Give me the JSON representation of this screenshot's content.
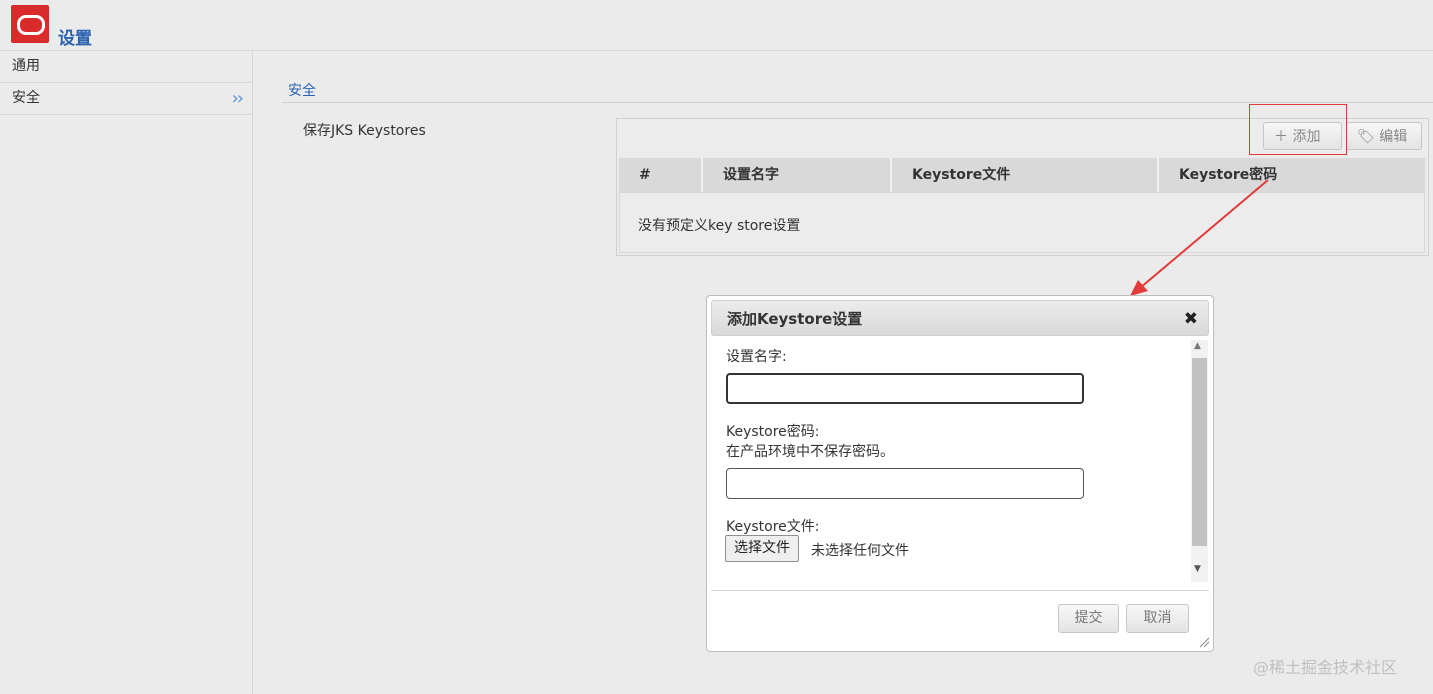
{
  "header": {
    "title": "设置"
  },
  "sidebar": {
    "items": [
      {
        "label": "通用"
      },
      {
        "label": "安全"
      }
    ]
  },
  "section": {
    "title": "安全",
    "field_label": "保存JKS Keystores"
  },
  "toolbar": {
    "add_label": "添加",
    "edit_label": "编辑"
  },
  "table": {
    "columns": [
      "#",
      "设置名字",
      "Keystore文件",
      "Keystore密码"
    ],
    "empty_message": "没有预定义key store设置"
  },
  "dialog": {
    "title": "添加Keystore设置",
    "name_label": "设置名字:",
    "name_value": "",
    "password_label": "Keystore密码:",
    "password_hint": "在产品环境中不保存密码。",
    "password_value": "",
    "file_label": "Keystore文件:",
    "file_button": "选择文件",
    "file_status": "未选择任何文件",
    "submit_label": "提交",
    "cancel_label": "取消"
  },
  "watermark": "@稀土掘金技术社区",
  "colors": {
    "accent": "#2a62b0",
    "brand": "#d92b2b",
    "annotation": "#e23b3b"
  }
}
